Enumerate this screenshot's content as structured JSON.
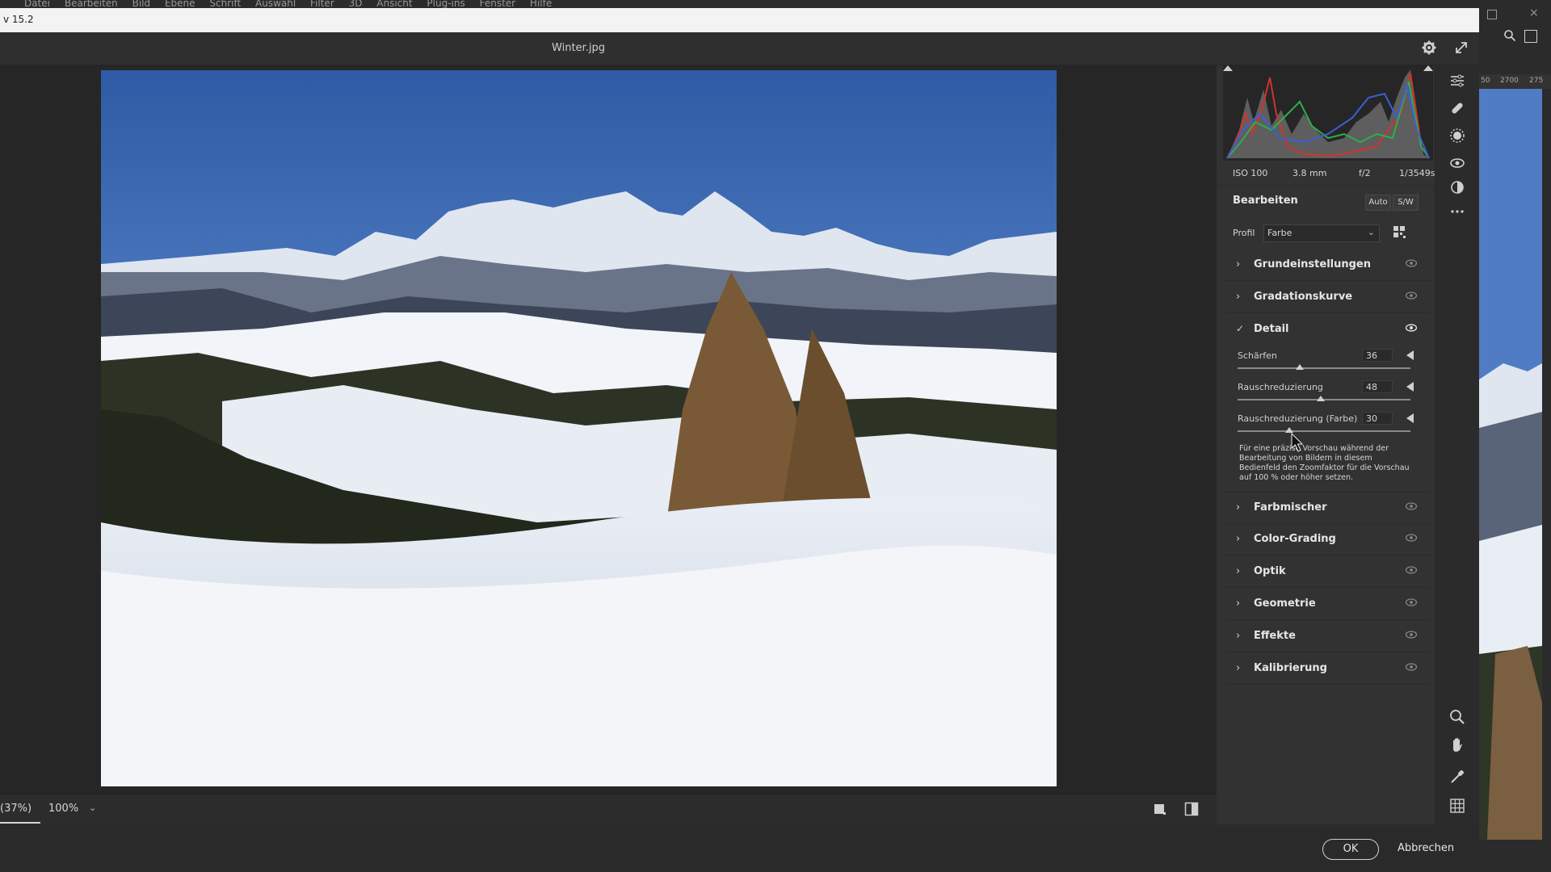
{
  "ps_menu": [
    "Datei",
    "Bearbeiten",
    "Bild",
    "Ebene",
    "Schrift",
    "Auswahl",
    "Filter",
    "3D",
    "Ansicht",
    "Plug-ins",
    "Fenster",
    "Hilfe"
  ],
  "dialog_title": "v 15.2",
  "file_name": "Winter.jpg",
  "histogram": {
    "exif": {
      "iso": "ISO 100",
      "focal": "3.8 mm",
      "aperture": "f/2",
      "shutter": "1/3549s"
    }
  },
  "edit": {
    "title": "Bearbeiten",
    "auto_label": "Auto",
    "bw_label": "S/W",
    "profile_label": "Profil",
    "profile_value": "Farbe"
  },
  "sections_top": [
    {
      "label": "Grundeinstellungen"
    },
    {
      "label": "Gradationskurve"
    }
  ],
  "detail": {
    "label": "Detail",
    "sliders": [
      {
        "name": "Schärfen",
        "value": "36",
        "level": 0.36
      },
      {
        "name": "Rauschreduzierung",
        "value": "48",
        "level": 0.48
      },
      {
        "name": "Rauschreduzierung (Farbe)",
        "value": "30",
        "level": 0.3
      }
    ],
    "note": "Für eine präzise Vorschau während der Bearbeitung von Bildern in diesem Bedienfeld den Zoomfaktor für die Vorschau auf 100 % oder höher setzen."
  },
  "sections_bottom": [
    {
      "label": "Farbmischer"
    },
    {
      "label": "Color-Grading"
    },
    {
      "label": "Optik"
    },
    {
      "label": "Geometrie"
    },
    {
      "label": "Effekte"
    },
    {
      "label": "Kalibrierung"
    }
  ],
  "zoom": {
    "fit_label": "(37%)",
    "value": "100%"
  },
  "footer": {
    "ok": "OK",
    "cancel": "Abbrechen"
  },
  "ps_ruler": [
    "50",
    "2700",
    "275"
  ]
}
